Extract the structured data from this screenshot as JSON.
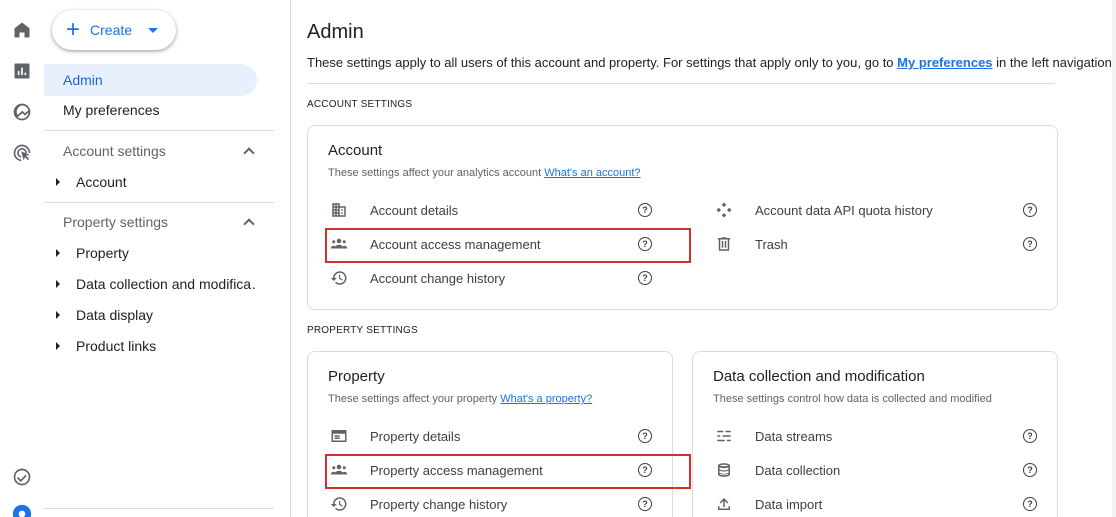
{
  "rail": {
    "icons": [
      "home-icon",
      "reports-icon",
      "explore-icon",
      "advertising-icon",
      "check-icon",
      "settings-icon"
    ]
  },
  "nav": {
    "create_label": "Create",
    "admin_label": "Admin",
    "preferences_label": "My preferences",
    "account_settings_label": "Account settings",
    "account_items": [
      "Account"
    ],
    "property_settings_label": "Property settings",
    "property_items": [
      "Property",
      "Data collection and modifica…",
      "Data display",
      "Product links"
    ]
  },
  "main": {
    "title": "Admin",
    "intro_text": "These settings apply to all users of this account and property. For settings that apply only to you, go to ",
    "intro_link": "My preferences",
    "intro_tail": " in the left navigation.",
    "account_section_heading": "ACCOUNT SETTINGS",
    "property_section_heading": "PROPERTY SETTINGS"
  },
  "account_card": {
    "title": "Account",
    "subtitle": "These settings affect your analytics account ",
    "subtitle_link": "What's an account?",
    "left_items": [
      "Account details",
      "Account access management",
      "Account change history"
    ],
    "right_items": [
      "Account data API quota history",
      "Trash"
    ]
  },
  "property_card": {
    "title": "Property",
    "subtitle": "These settings affect your property ",
    "subtitle_link": "What's a property?",
    "items": [
      "Property details",
      "Property access management",
      "Property change history"
    ]
  },
  "data_card": {
    "title": "Data collection and modification",
    "subtitle": "These settings control how data is collected and modified",
    "items": [
      "Data streams",
      "Data collection",
      "Data import"
    ]
  },
  "help_glyph": "?",
  "colors": {
    "accent": "#1a73e8",
    "highlight": "#d32f2f",
    "nav_active_bg": "#e8f0fe"
  }
}
